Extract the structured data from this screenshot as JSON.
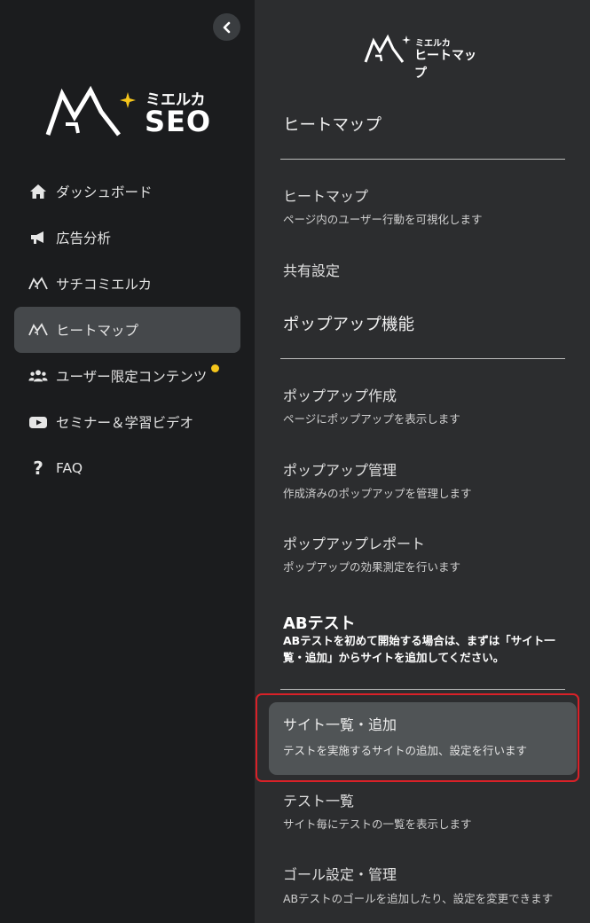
{
  "sidebar": {
    "logo": {
      "brand_jp": "ミエルカ",
      "product": "SEO"
    },
    "items": [
      {
        "label": "ダッシュボード",
        "icon": "home-icon"
      },
      {
        "label": "広告分析",
        "icon": "megaphone-icon"
      },
      {
        "label": "サチコミエルカ",
        "icon": "mieruca-logo-icon"
      },
      {
        "label": "ヒートマップ",
        "icon": "mieruca-logo-icon",
        "active": true
      },
      {
        "label": "ユーザー限定コンテンツ",
        "icon": "users-icon",
        "badge_color": "#f5c51b"
      },
      {
        "label": "セミナー＆学習ビデオ",
        "icon": "youtube-icon"
      },
      {
        "label": "FAQ",
        "icon": "question-icon"
      }
    ]
  },
  "panel": {
    "logo": {
      "brand_jp": "ミエルカ",
      "product": "ヒートマップ"
    },
    "sections": {
      "heatmap": "ヒートマップ",
      "popup": "ポップアップ機能"
    },
    "heatmap_items": [
      {
        "title": "ヒートマップ",
        "desc": "ページ内のユーザー行動を可視化します"
      },
      {
        "title": "共有設定",
        "desc": ""
      }
    ],
    "popup_items": [
      {
        "title": "ポップアップ作成",
        "desc": "ページにポップアップを表示します"
      },
      {
        "title": "ポップアップ管理",
        "desc": "作成済みのポップアップを管理します"
      },
      {
        "title": "ポップアップレポート",
        "desc": "ポップアップの効果測定を行います"
      }
    ],
    "ab": {
      "title": "ABテスト",
      "note": "ABテストを初めて開始する場合は、まずは「サイト一覧・追加」からサイトを追加してください。",
      "items": [
        {
          "title": "サイト一覧・追加",
          "desc": "テストを実施するサイトの追加、設定を行います",
          "highlighted": true
        },
        {
          "title": "テスト一覧",
          "desc": "サイト毎にテストの一覧を表示します"
        },
        {
          "title": "ゴール設定・管理",
          "desc": "ABテストのゴールを追加したり、設定を変更できます"
        }
      ]
    }
  },
  "colors": {
    "highlight_border": "#d92128",
    "badge": "#f5c51b",
    "active_bg": "#45484b"
  }
}
